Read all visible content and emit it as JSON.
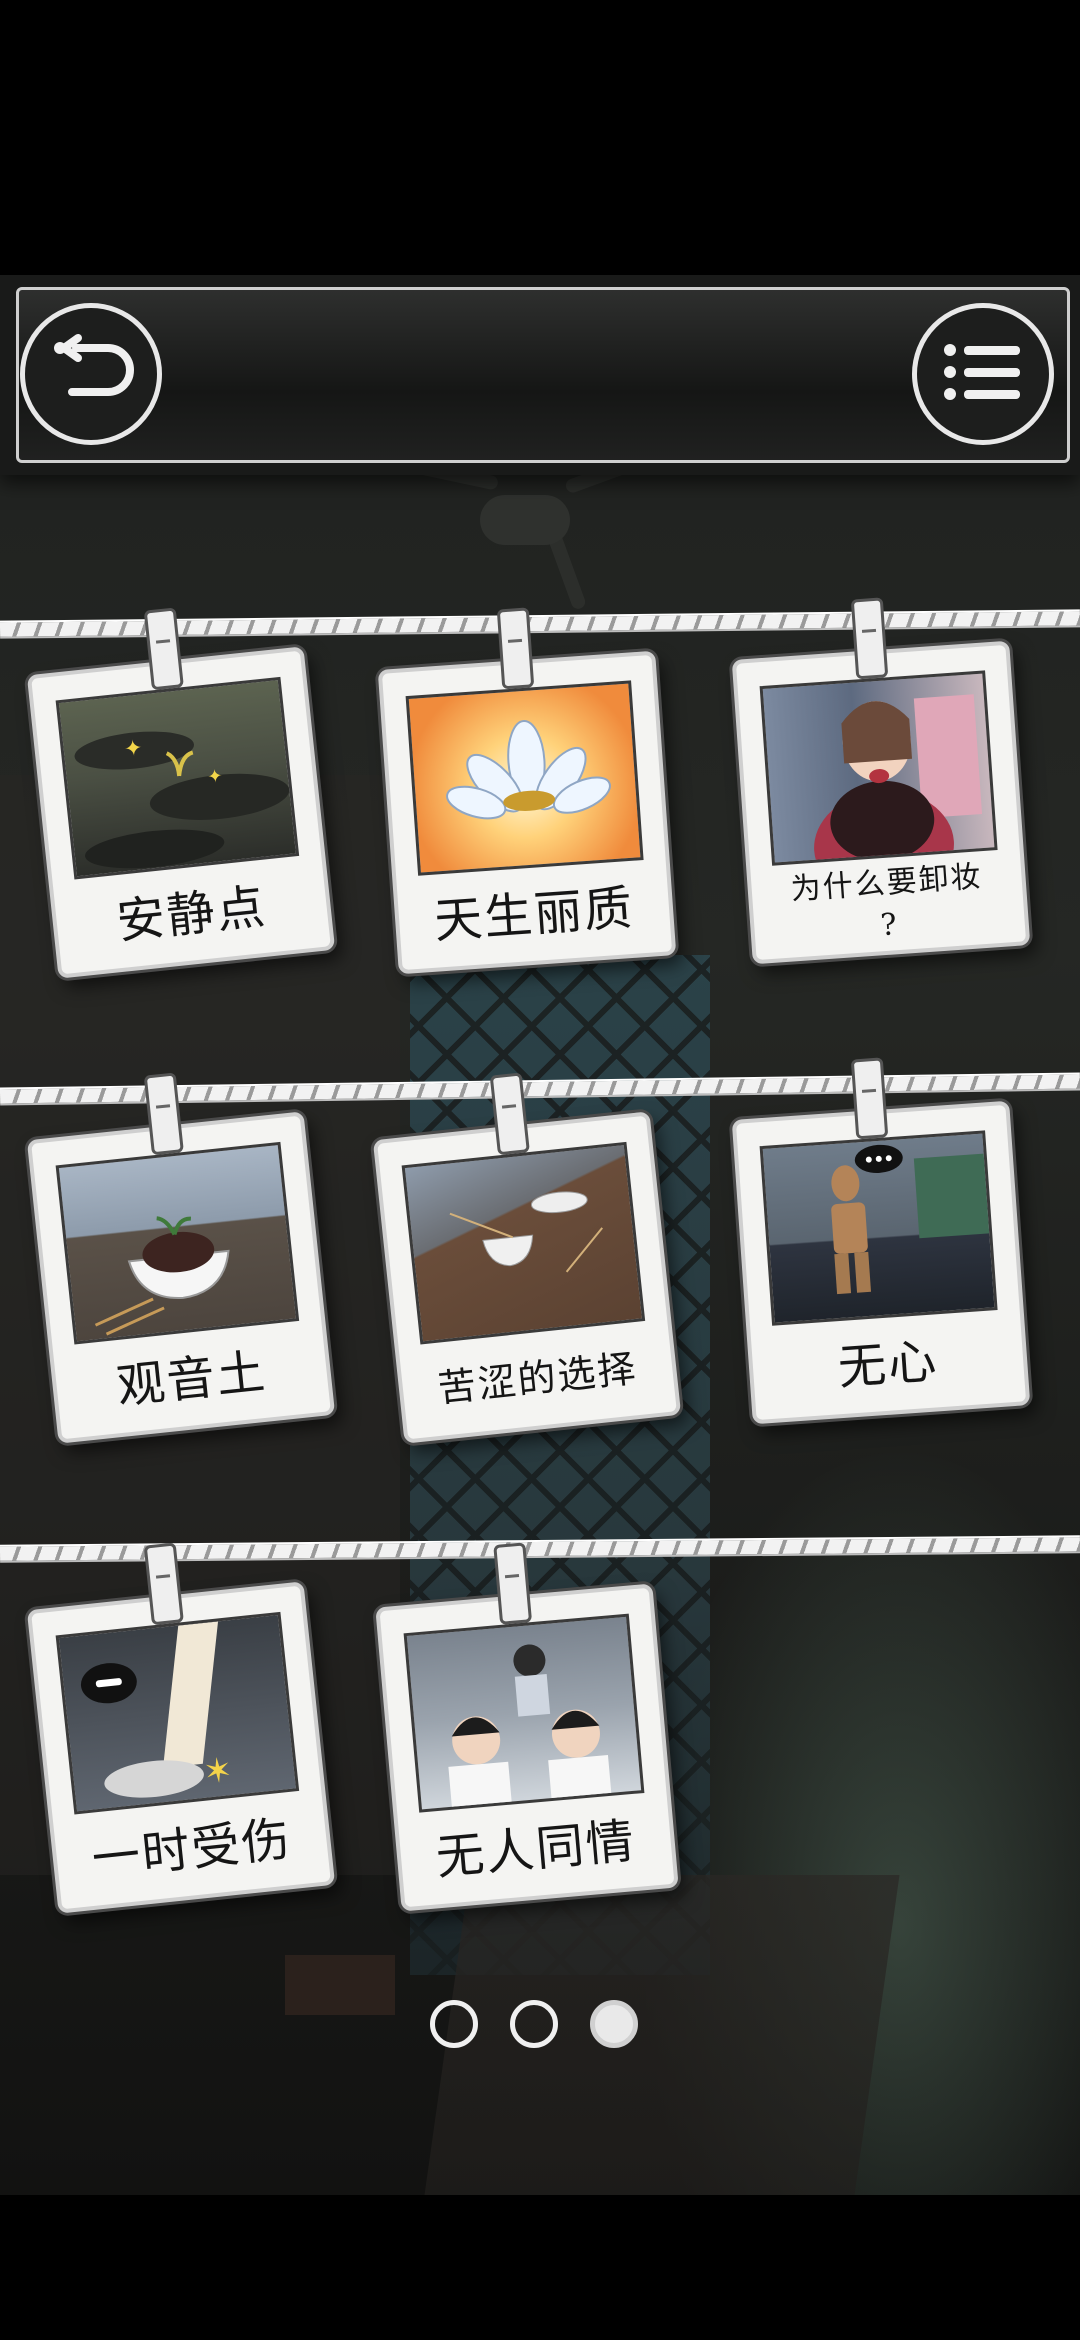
{
  "header": {
    "back_icon": "back-arrow-icon",
    "menu_icon": "list-menu-icon"
  },
  "cards": [
    {
      "caption": "安静点",
      "scene": "sprout-on-rock"
    },
    {
      "caption": "天生丽质",
      "scene": "lotus-glow"
    },
    {
      "caption": "为什么要卸妆",
      "caption_line2": "?",
      "scene": "woman-covering-face"
    },
    {
      "caption": "观音土",
      "scene": "bowl-of-soil"
    },
    {
      "caption": "苦涩的选择",
      "scene": "empty-bowls-on-table"
    },
    {
      "caption": "无心",
      "scene": "wooden-mannequin"
    },
    {
      "caption": "一时受伤",
      "scene": "stepping-foot"
    },
    {
      "caption": "无人同情",
      "scene": "schoolboys"
    }
  ],
  "pager": {
    "pages": 3,
    "current": 3
  },
  "colors": {
    "background": "#000000",
    "card": "#f4f4f2",
    "string": "#f2f2f2",
    "accent_glow": "#96c8aa"
  }
}
